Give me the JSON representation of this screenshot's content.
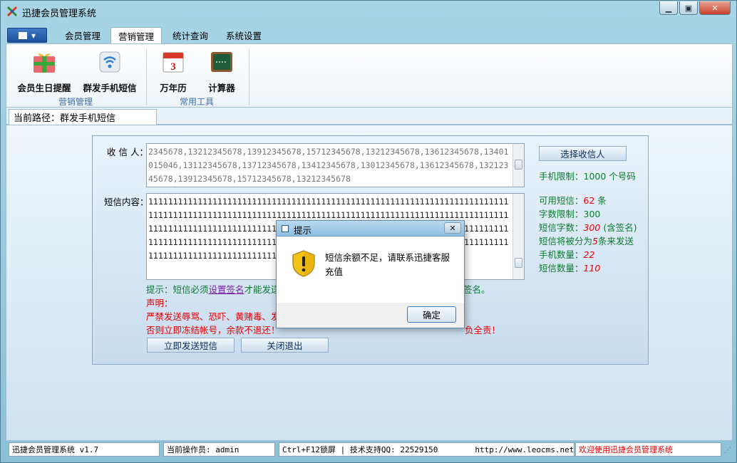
{
  "window": {
    "title": "迅捷会员管理系统"
  },
  "tabs": [
    "会员管理",
    "营销管理",
    "统计查询",
    "系统设置"
  ],
  "ribbon": {
    "items": [
      {
        "label": "会员生日提醒",
        "icon": "gift-icon"
      },
      {
        "label": "群发手机短信",
        "icon": "wifi-signal-icon"
      },
      {
        "label": "万年历",
        "icon": "calendar-icon"
      },
      {
        "label": "计算器",
        "icon": "calculator-icon"
      }
    ],
    "calendar_day": "3",
    "groups": [
      "营销管理",
      "常用工具"
    ]
  },
  "breadcrumb": "当前路径：群发手机短信",
  "form": {
    "recipient_label": "收 信 人：",
    "recipients": "2345678,13212345678,13912345678,15712345678,13212345678,13612345678,13401015046,13112345678,13712345678,13412345678,13012345678,13612345678,13212345678,13912345678,15712345678,13212345678",
    "content_label": "短信内容：",
    "content": "11111111111111111111111111111111111111111111111111111111111111111111111111111111111111111111111111111111111111111111111111111111111111111111111111111111111111111111111111111111111111111111111111111111111111111111111111111111111111111111111111111111111111111111111111111111111111111111111111111111111111111111111111111111111111111111111111111",
    "hint_prefix": "提示：短信必须",
    "hint_link": "设置签名",
    "hint_suffix": "才能发送",
    "hint_tail": "签名。",
    "declaration_title": "声明：",
    "declaration_line1": "严禁发送辱骂、恐吓、黄赌毒、发",
    "declaration_line2": "否则立即冻结帐号，余款不退还！",
    "declaration_tail": "负全责！",
    "send_button": "立即发送短信",
    "close_button": "关闭退出"
  },
  "side": {
    "select_button": "选择收信人",
    "phone_limit": "手机限制：1000 个号码",
    "available_label": "可用短信：",
    "available_value": "62",
    "available_unit": " 条",
    "word_limit": "字数限制：300",
    "sms_chars_label": "短信字数：",
    "sms_chars_value": "300",
    "sms_chars_unit": " (含签名)",
    "split_prefix": "短信将被分为",
    "split_value": "5",
    "split_suffix": "条来发送",
    "phone_count_label": "手机数量：",
    "phone_count_value": "22",
    "sms_count_label": "短信数量：",
    "sms_count_value": "110"
  },
  "dialog": {
    "title": "提示",
    "message": "短信余额不足，请联系迅捷客服充值",
    "ok_button": "确定",
    "icon": "warning-shield-icon"
  },
  "status": {
    "version": "迅捷会员管理系统 v1.7",
    "operator": "当前操作员: admin",
    "support": "Ctrl+F12锁屏 | 技术支持QQ:  22529150",
    "url": "http://www.leocms.net",
    "welcome": "欢迎使用迅捷会员管理系统"
  },
  "colors": {
    "accent": "#1b4f9e",
    "green_text": "#0c7a2e",
    "red_text": "#e00000",
    "window_bg": "#8fc3d9"
  }
}
